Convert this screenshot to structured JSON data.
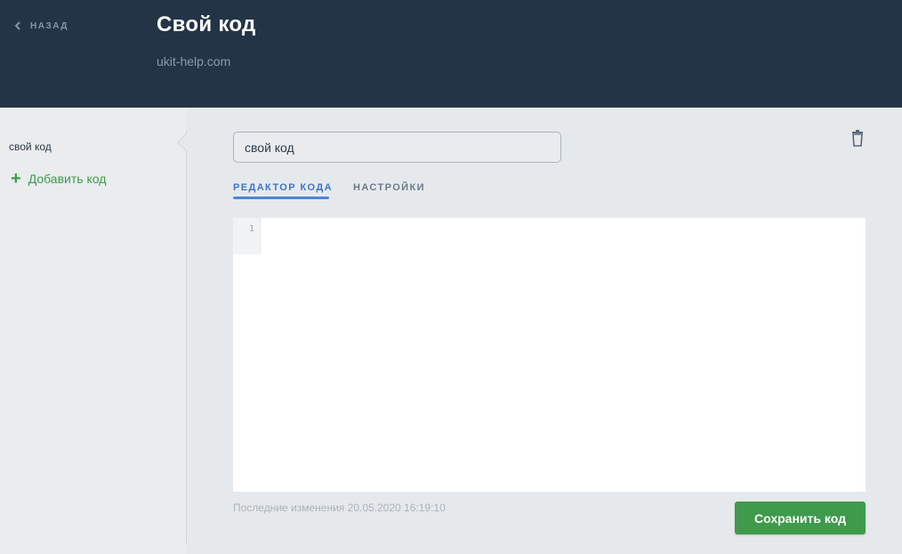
{
  "header": {
    "back_label": "НАЗАД",
    "title": "Свой код",
    "subtitle": "ukit-help.com"
  },
  "sidebar": {
    "items": [
      {
        "label": "свой код"
      }
    ],
    "add_label": "Добавить код"
  },
  "main": {
    "name_input": {
      "value": "свой код"
    },
    "tabs": [
      {
        "label": "РЕДАКТОР КОДА",
        "active": true
      },
      {
        "label": "НАСТРОЙКИ",
        "active": false
      }
    ],
    "editor": {
      "line_numbers": [
        "1"
      ],
      "content": ""
    },
    "last_modified": "Последние изменения 20.05.2020 16:19:10",
    "save_label": "Сохранить код"
  },
  "icons": {
    "back": "chevron-left-icon",
    "add": "plus-icon",
    "delete": "trash-icon"
  },
  "colors": {
    "header_bg": "#243447",
    "accent_blue": "#4a86d8",
    "accent_green": "#3f9a4c"
  }
}
